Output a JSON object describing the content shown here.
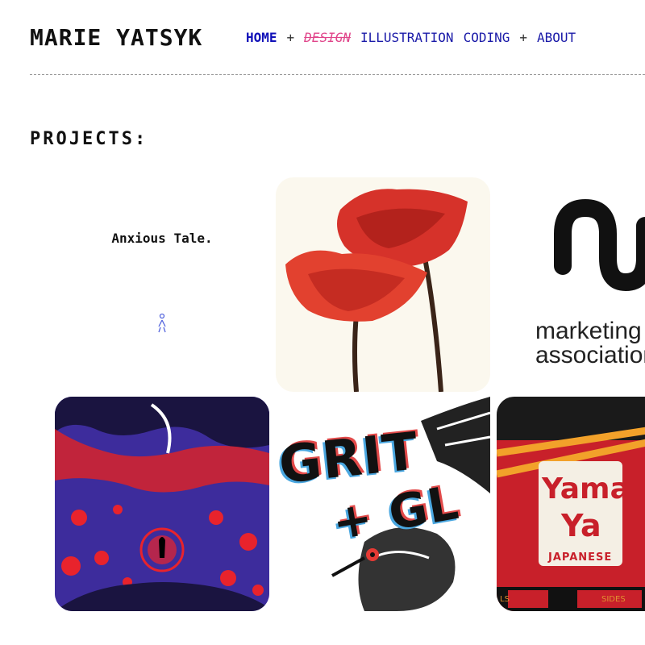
{
  "header": {
    "site_title": "MARIE YATSYK",
    "nav": {
      "home": "HOME",
      "sep1": "+",
      "design": "DESIGN",
      "illustration": "ILLUSTRATION",
      "coding": "CODING",
      "sep2": "+",
      "about": "ABOUT"
    }
  },
  "projects": {
    "heading": "PROJECTS:",
    "tiles": [
      {
        "title": "Anxious Tale."
      },
      {},
      {
        "text_line1": "marketing",
        "text_line2": "association"
      },
      {},
      {
        "text_line1": "GRIT",
        "text_line2": "+ GL"
      },
      {
        "word1": "Yama",
        "word2": "Ya",
        "subtitle": "JAPANESE",
        "left_label": "LS",
        "right_label": "SIDES"
      }
    ]
  },
  "colors": {
    "nav_link": "#1a1aa8",
    "nav_design": "#e0458a",
    "poppy_red": "#d6322a",
    "night_purple": "#3d2c9c",
    "yama_red": "#c8202a"
  }
}
